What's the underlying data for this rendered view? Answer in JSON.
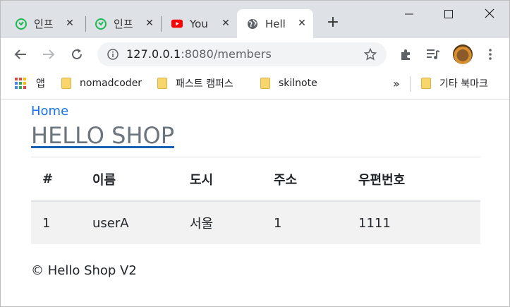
{
  "browser": {
    "tabs": [
      {
        "title": "인프",
        "icon": "inflearn-icon"
      },
      {
        "title": "인프",
        "icon": "inflearn-icon"
      },
      {
        "title": "You",
        "icon": "youtube-icon"
      },
      {
        "title": "Hell",
        "icon": "globe-icon",
        "active": true
      }
    ],
    "new_tab": "+",
    "url_host": "127.0.0.1",
    "url_rest": ":8080/members",
    "bookmarks": [
      {
        "label": "앱",
        "icon": "apps-grid-icon"
      },
      {
        "label": "nomadcoder",
        "icon": "folder-icon"
      },
      {
        "label": "패스트 캠퍼스",
        "icon": "folder-icon"
      },
      {
        "label": "skilnote",
        "icon": "folder-icon"
      }
    ],
    "bookmarks_overflow": "»",
    "other_bookmarks": "기타 북마크",
    "colors": {
      "tabstrip": "#dee1e6",
      "omnibox": "#f1f3f4",
      "folder": "#f9d66b",
      "youtube": "#ff0000",
      "inflearn": "#1db954"
    }
  },
  "page": {
    "home_link": "Home",
    "title": "HELLO SHOP",
    "table": {
      "headers": [
        "#",
        "이름",
        "도시",
        "주소",
        "우편번호"
      ],
      "rows": [
        [
          "1",
          "userA",
          "서울",
          "1",
          "1111"
        ]
      ]
    },
    "footer": "© Hello Shop V2"
  }
}
